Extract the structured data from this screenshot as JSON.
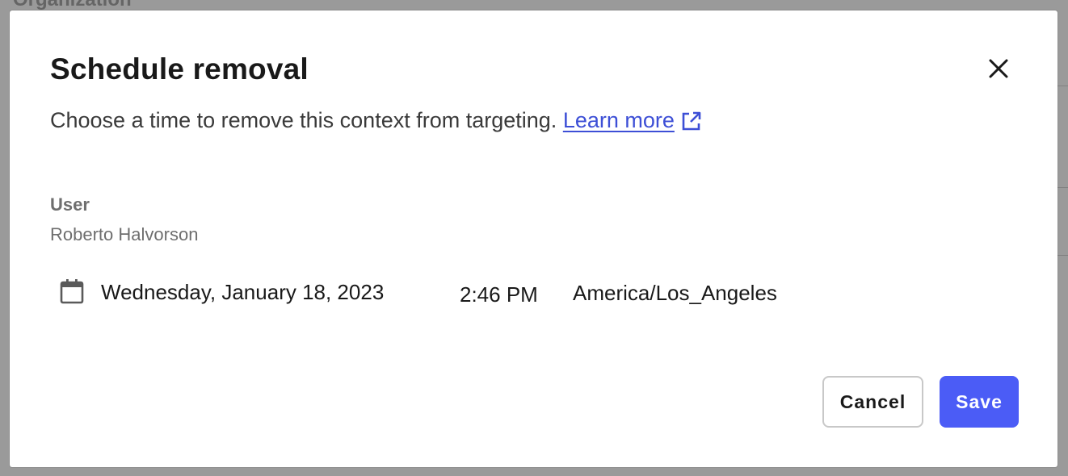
{
  "background": {
    "title": "Organization"
  },
  "modal": {
    "title": "Schedule removal",
    "description": "Choose a time to remove this context from targeting.",
    "learn_more": "Learn more",
    "field": {
      "label": "User",
      "value": "Roberto Halvorson"
    },
    "schedule": {
      "date": "Wednesday, January 18, 2023",
      "time": "2:46 PM",
      "timezone": "America/Los_Angeles"
    },
    "buttons": {
      "cancel": "Cancel",
      "save": "Save"
    }
  },
  "colors": {
    "accent": "#4b5cf6",
    "link": "#3d4fd6",
    "overlay": "#9a9a9a"
  },
  "icons": {
    "close": "close-icon",
    "external_link": "external-link-icon",
    "calendar": "calendar-icon"
  }
}
